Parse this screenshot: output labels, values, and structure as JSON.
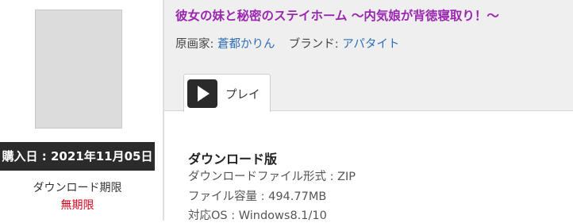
{
  "product": {
    "purchase_date_label": "購入日 : 2021年11月05日",
    "download_deadline_label": "ダウンロード期限",
    "download_deadline_value": "無期限"
  },
  "header": {
    "title": "彼女の妹と秘密のステイホーム ～内気娘が背徳寝取り！～",
    "artist_label": "原画家:",
    "artist_name": "蒼都かりん",
    "brand_label": "ブランド:",
    "brand_name": "アパタイト"
  },
  "tabs": [
    {
      "label": "プレイ",
      "icon": "play-icon"
    }
  ],
  "download_info": {
    "heading": "ダウンロード版",
    "format": "ダウンロードファイル形式 : ZIP",
    "size": "ファイル容量 : 494.77MB",
    "os": "対応OS :  Windows8.1/10"
  },
  "colors": {
    "title": "#9b27b0",
    "link": "#2e6fb5",
    "deadline": "#d0021b",
    "purchase_bar": "#2b2b2b"
  }
}
